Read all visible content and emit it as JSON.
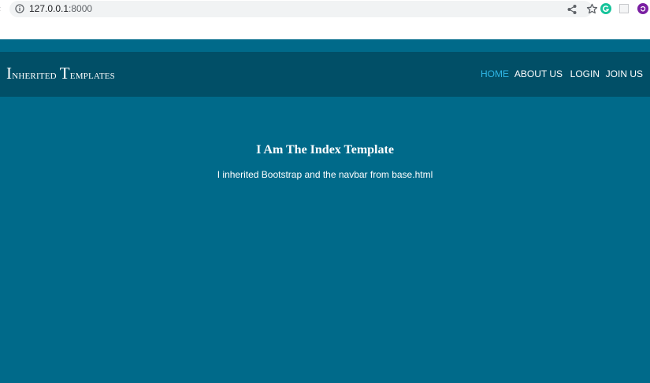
{
  "browser": {
    "url_host": "127.0.0.1",
    "url_port": ":8000",
    "icons": [
      "info-icon",
      "share-icon",
      "star-icon",
      "grammarly-extension-icon",
      "blank-extension-icon",
      "purple-extension-icon"
    ]
  },
  "navbar": {
    "brand_first_letter_1": "I",
    "brand_rest_1": "nherited",
    "brand_first_letter_2": "T",
    "brand_rest_2": "emplates",
    "links": [
      {
        "label": "HOME",
        "active": true
      },
      {
        "label": "ABOUT US",
        "active": false
      },
      {
        "label": "LOGIN",
        "active": false
      },
      {
        "label": "JOIN US",
        "active": false
      }
    ]
  },
  "content": {
    "title": "I Am The Index Template",
    "text": "I inherited Bootstrap and the navbar from base.html"
  },
  "colors": {
    "page_background": "#006a8a",
    "navbar_background": "#014f67",
    "active_link": "#2fb6e6"
  }
}
